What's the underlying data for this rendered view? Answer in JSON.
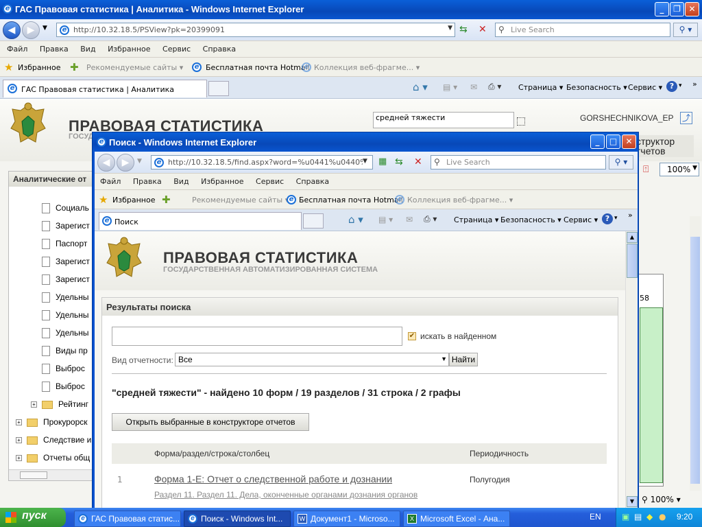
{
  "outer": {
    "title": "ГАС Правовая статистика | Аналитика - Windows Internet Explorer",
    "address": "http://10.32.18.5/PSView?pk=20399091",
    "live_search": "Live Search",
    "menu": [
      "Файл",
      "Правка",
      "Вид",
      "Избранное",
      "Сервис",
      "Справка"
    ],
    "favorites_label": "Избранное",
    "fav_links": [
      "Рекомендуемые сайты ▾",
      "Бесплатная почта Hotmail",
      "Коллекция веб-фрагме... ▾"
    ],
    "tab": "ГАС Правовая статистика | Аналитика",
    "cmd": [
      "Страница ▾",
      "Безопасность ▾",
      "Сервис ▾"
    ],
    "search_box": "средней тяжести",
    "user": "GORSHECHNIKOVA_EP",
    "constructor": [
      "структор",
      "тчетов"
    ],
    "zoom": "100%",
    "zoom_status": "100%",
    "panel_title": "Аналитические от",
    "grid_number": "58",
    "tree": [
      "Социаль",
      "Зарегист",
      "Паспорт",
      "Зарегист",
      "Зарегист",
      "Удельны",
      "Удельны",
      "Удельны",
      "Виды пр",
      "Выброс",
      "Выброс",
      "Рейтинг",
      "Прокурорск",
      "Следствие и",
      "Отчеты общ"
    ],
    "site_title": "ПРАВОВАЯ СТАТИСТИКА",
    "site_sub": "ГОСУДАР"
  },
  "popup": {
    "title": "Поиск - Windows Internet Explorer",
    "address": "http://10.32.18.5/find.aspx?word=%u0441%u0440%u0",
    "live_search": "Live Search",
    "menu": [
      "Файл",
      "Правка",
      "Вид",
      "Избранное",
      "Сервис",
      "Справка"
    ],
    "favorites_label": "Избранное",
    "fav_links": [
      "Рекомендуемые сайты ▾",
      "Бесплатная почта Hotmail",
      "Коллекция веб-фрагме... ▾"
    ],
    "tab": "Поиск",
    "cmd": [
      "Страница ▾",
      "Безопасность ▾",
      "Сервис ▾"
    ],
    "site_title": "ПРАВОВАЯ СТАТИСТИКА",
    "site_sub": "ГОСУДАРСТВЕННАЯ АВТОМАТИЗИРОВАННАЯ СИСТЕМА",
    "results_title": "Результаты поиска",
    "search_value": "",
    "search_in_found": "искать в найденном",
    "report_type_label": "Вид отчетности:",
    "report_type_value": "Все",
    "find_button": "Найти",
    "summary": "\"средней тяжести\" - найдено 10 форм / 19 разделов / 31 строка / 2 графы",
    "open_button": "Открыть выбранные в конструкторе отчетов",
    "col_form": "Форма/раздел/строка/столбец",
    "col_period": "Периодичность",
    "row_num": "1",
    "row_form": "Форма 1-Е: Отчет о следственной работе и дознании",
    "row_sub": "Раздел 11. Раздел 11. Дела, оконченные органами дознания органов",
    "row_period": "Полугодия"
  },
  "taskbar": {
    "start": "пуск",
    "items": [
      "ГАС Правовая статис...",
      "Поиск - Windows Int...",
      "Документ1 - Microso...",
      "Microsoft Excel - Ана..."
    ],
    "lang": "EN",
    "clock": "9:20"
  }
}
